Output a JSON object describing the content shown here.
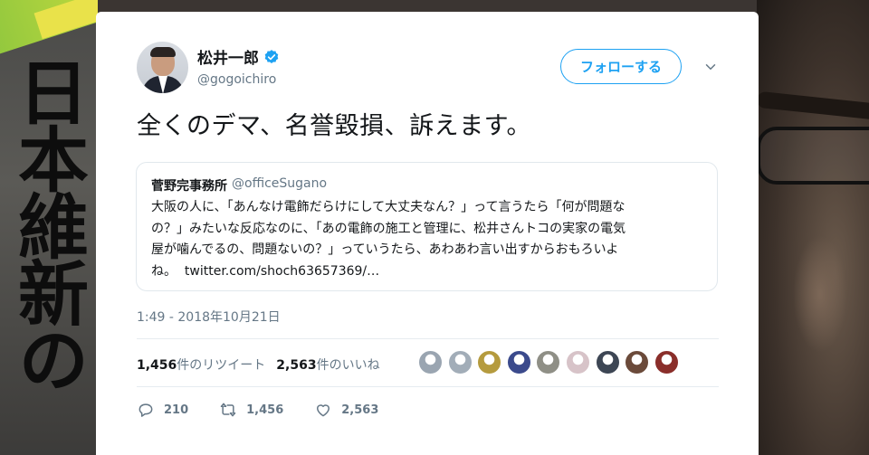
{
  "background": {
    "banner_text": "日本維新の会"
  },
  "tweet": {
    "display_name": "松井一郎",
    "handle": "@gogoichiro",
    "follow_label": "フォローする",
    "text": "全くのデマ、名誉毀損、訴えます。",
    "timestamp": "1:49 - 2018年10月21日",
    "retweet_count": "1,456",
    "retweet_label": "件のリツイート",
    "like_count": "2,563",
    "like_label": "件のいいね",
    "reply_action_count": "210",
    "retweet_action_count": "1,456",
    "like_action_count": "2,563"
  },
  "quote": {
    "name": "菅野完事務所",
    "handle": "@officeSugano",
    "lines": [
      "大阪の人に、「あんなけ電飾だらけにして大丈夫なん？」って言うたら「何が問題な",
      "の？」みたいな反応なのに、「あの電飾の施工と管理に、松井さんトコの実家の電気",
      "屋が噛んでるの、問題ないの？」っていうたら、あわあわ言い出すからおもろいよ",
      "ね。"
    ],
    "link": "twitter.com/shoch63657369/…"
  },
  "colors": {
    "accent": "#1da1f2",
    "muted": "#657786",
    "text": "#14171a",
    "border": "#e1e8ed"
  },
  "likers": [
    {
      "color": "#9aa5b1"
    },
    {
      "color": "#a2adb8"
    },
    {
      "color": "#b59b3e"
    },
    {
      "color": "#3b4a8c"
    },
    {
      "color": "#8f8f86"
    },
    {
      "color": "#d7c3c8"
    },
    {
      "color": "#3d4654"
    },
    {
      "color": "#6b4a3a"
    },
    {
      "color": "#8a2e2a"
    }
  ]
}
